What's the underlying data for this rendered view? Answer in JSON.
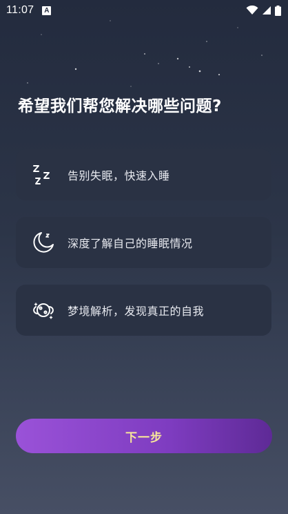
{
  "status_bar": {
    "time": "11:07",
    "notification_letter": "A",
    "icons": [
      "wifi-icon",
      "cellular-signal-icon",
      "battery-icon"
    ]
  },
  "question": "希望我们帮您解决哪些问题?",
  "options": [
    {
      "icon": "zzz-sleep-icon",
      "label": "告别失眠，快速入睡"
    },
    {
      "icon": "moon-icon",
      "label": "深度了解自己的睡眠情况"
    },
    {
      "icon": "dream-planet-icon",
      "label": "梦境解析，发现真正的自我"
    }
  ],
  "next_button_label": "下一步",
  "colors": {
    "background_top": "#232b3e",
    "background_bottom": "#474f64",
    "card": "#2a3244",
    "button_gradient_start": "#9a52d8",
    "button_gradient_end": "#5e2a96",
    "button_text": "#f6e59a"
  }
}
